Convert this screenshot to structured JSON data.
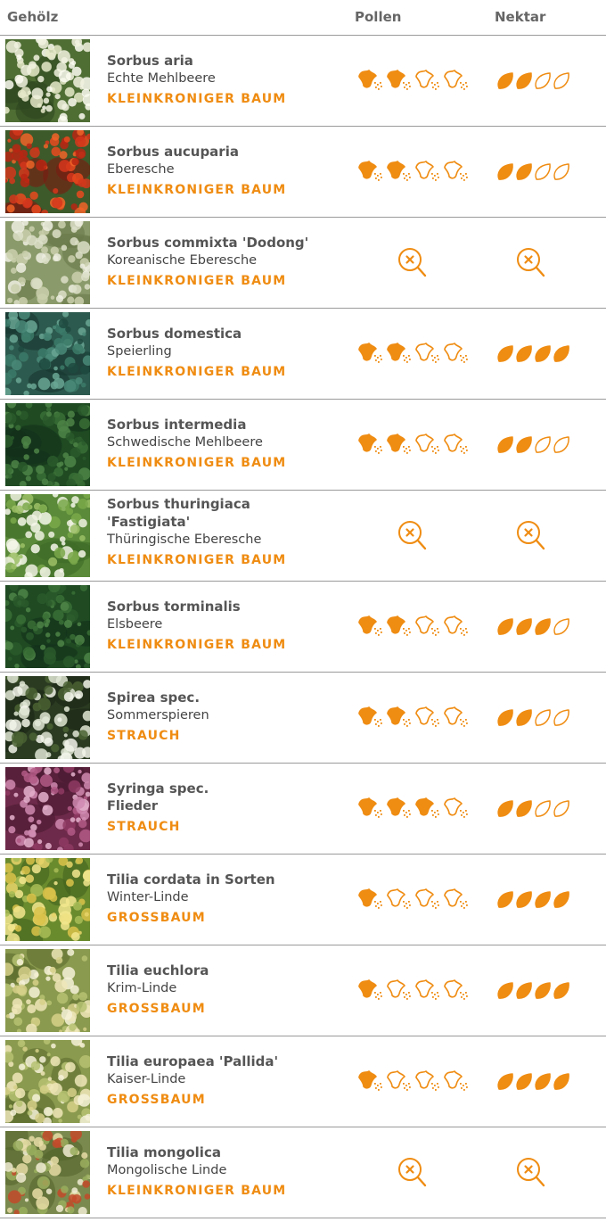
{
  "header": {
    "name_label": "Gehölz",
    "pollen_label": "Pollen",
    "nektar_label": "Nektar"
  },
  "colors": {
    "accent": "#ef8c12",
    "divider": "#9a9a9a",
    "text_dark": "#555555"
  },
  "icons": {
    "pollen": "pollen-cup-icon",
    "nektar": "nectar-drop-icon",
    "unknown": "magnifier-x-icon"
  },
  "plants": [
    {
      "latin": "Sorbus aria",
      "common": "Echte Mehlbeere",
      "type": "KLEINKRONIGER BAUM",
      "pollen": 2,
      "nektar": 2,
      "thumb": "white-blossom"
    },
    {
      "latin": "Sorbus aucuparia",
      "common": "Eberesche",
      "type": "KLEINKRONIGER BAUM",
      "pollen": 2,
      "nektar": 2,
      "thumb": "red-berries"
    },
    {
      "latin": "Sorbus commixta 'Dodong'",
      "common": "Koreanische Eberesche",
      "type": "KLEINKRONIGER BAUM",
      "pollen": null,
      "nektar": null,
      "thumb": "pale-blossom"
    },
    {
      "latin": "Sorbus domestica",
      "common": "Speierling",
      "type": "KLEINKRONIGER BAUM",
      "pollen": 2,
      "nektar": 4,
      "thumb": "teal-leaves"
    },
    {
      "latin": "Sorbus intermedia",
      "common": "Schwedische Mehlbeere",
      "type": "KLEINKRONIGER BAUM",
      "pollen": 2,
      "nektar": 2,
      "thumb": "dark-leaf"
    },
    {
      "latin_lines": [
        "Sorbus thuringiaca",
        "'Fastigiata'"
      ],
      "common": "Thüringische Eberesche",
      "type": "KLEINKRONIGER BAUM",
      "pollen": null,
      "nektar": null,
      "thumb": "green-white"
    },
    {
      "latin": "Sorbus torminalis",
      "common": "Elsbeere",
      "type": "KLEINKRONIGER BAUM",
      "pollen": 2,
      "nektar": 3,
      "thumb": "dark-leaf"
    },
    {
      "latin": "Spirea spec.",
      "common": "Sommerspieren",
      "type": "STRAUCH",
      "pollen": 2,
      "nektar": 2,
      "thumb": "white-spray"
    },
    {
      "latin": "Syringa spec.",
      "common": "Flieder",
      "common_bold": true,
      "type": "STRAUCH",
      "pollen": 3,
      "nektar": 2,
      "thumb": "lilac"
    },
    {
      "latin": "Tilia cordata in Sorten",
      "common": "Winter-Linde",
      "type": "GROSSBAUM",
      "pollen": 1,
      "nektar": 4,
      "thumb": "linden-yellow"
    },
    {
      "latin": "Tilia euchlora",
      "common": "Krim-Linde",
      "type": "GROSSBAUM",
      "pollen": 1,
      "nektar": 4,
      "thumb": "linden-pale"
    },
    {
      "latin": "Tilia europaea 'Pallida'",
      "common": "Kaiser-Linde",
      "type": "GROSSBAUM",
      "pollen": 1,
      "nektar": 4,
      "thumb": "linden-pale"
    },
    {
      "latin": "Tilia mongolica",
      "common": "Mongolische Linde",
      "type": "KLEINKRONIGER BAUM",
      "pollen": null,
      "nektar": null,
      "thumb": "linden-red"
    }
  ]
}
